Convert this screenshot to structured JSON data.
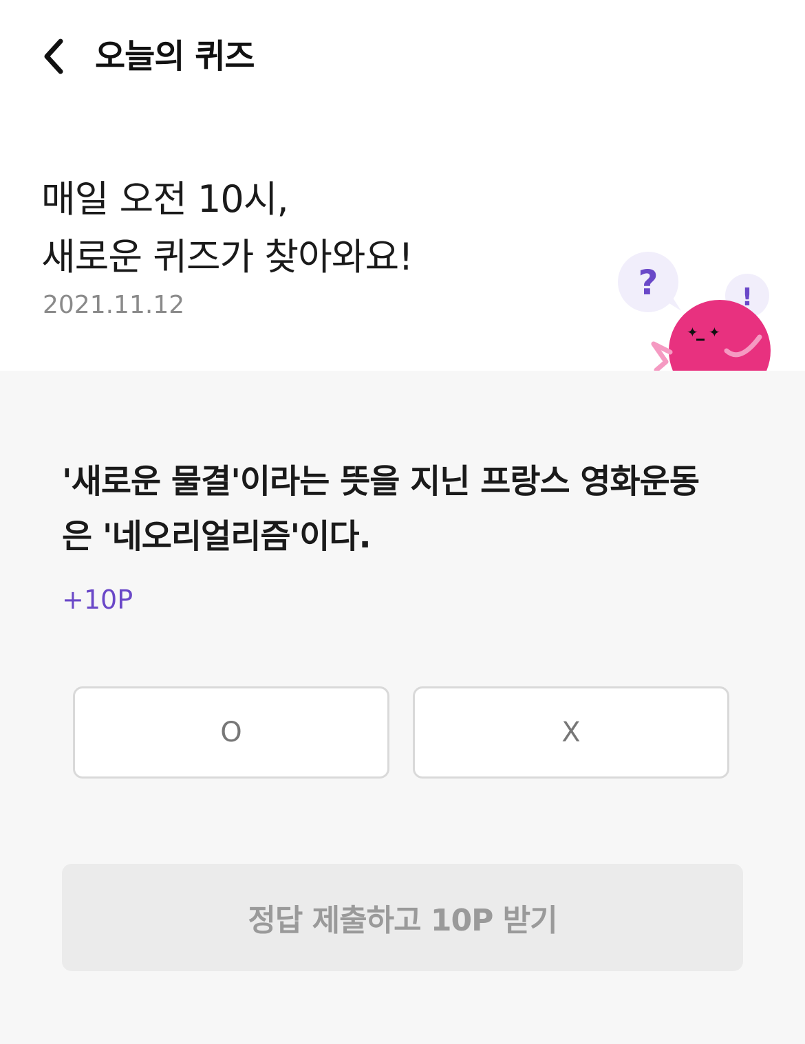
{
  "header": {
    "title": "오늘의 퀴즈",
    "back_icon": "chevron-left-icon"
  },
  "intro": {
    "line1": "매일 오전 10시,",
    "line2": "새로운 퀴즈가 찾아와요!",
    "date": "2021.11.12"
  },
  "mascot": {
    "question_mark": "?",
    "exclamation_mark": "!",
    "body_color": "#e8317f",
    "bubble_color": "#f1eefb",
    "accent_color": "#6a48c8"
  },
  "quiz": {
    "question_line1": "'새로운 물결'이라는 뜻을 지닌 프랑스 영화운동",
    "question_line2": "은 '네오리얼리즘'이다.",
    "reward": "+10P",
    "options": [
      {
        "label": "O"
      },
      {
        "label": "X"
      }
    ],
    "submit_label": "정답 제출하고 10P 받기"
  },
  "colors": {
    "accent": "#6a48c8",
    "background": "#f7f7f7",
    "card": "#ffffff",
    "disabled_button": "#ebebeb"
  }
}
